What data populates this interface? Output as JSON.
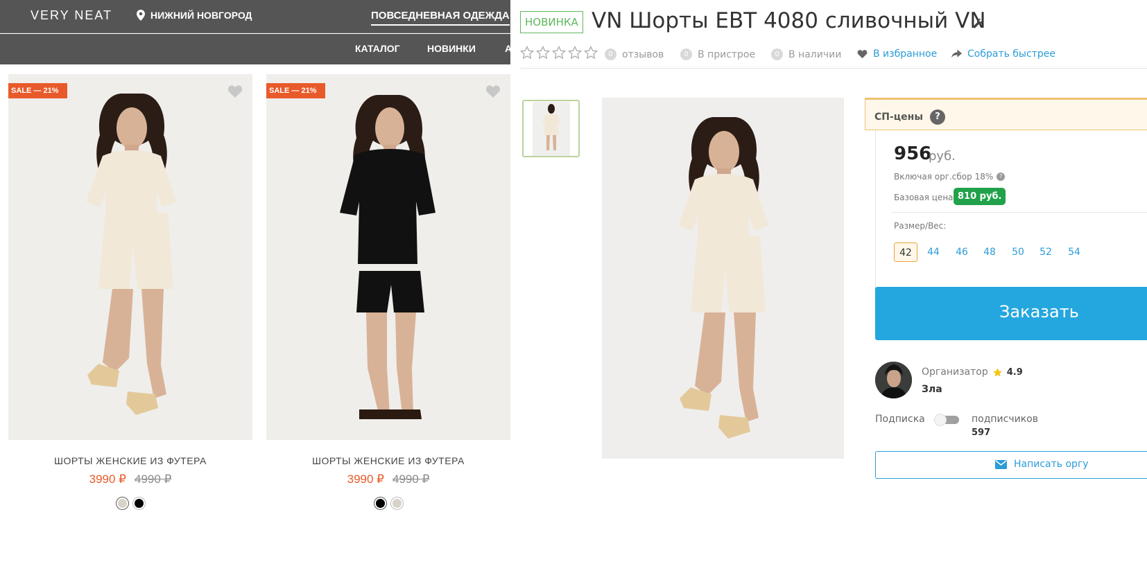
{
  "store": {
    "logo": "VERY NEAT",
    "city": "НИЖНИЙ НОВГОРОД",
    "category_link": "ПОВСЕДНЕВНАЯ ОДЕЖДА",
    "nav": [
      "КАТАЛОГ",
      "НОВИНКИ",
      "А"
    ],
    "products": [
      {
        "sale_badge": "SALE — 21%",
        "title": "ШОРТЫ ЖЕНСКИЕ ИЗ ФУТЕРА",
        "price": "3990 ₽",
        "old_price": "4990 ₽",
        "colors": [
          "#d8d3c8",
          "#000000"
        ],
        "selected_color": 0
      },
      {
        "sale_badge": "SALE — 21%",
        "title": "ШОРТЫ ЖЕНСКИЕ ИЗ ФУТЕРА",
        "price": "3990 ₽",
        "old_price": "4990 ₽",
        "colors": [
          "#000000",
          "#d8d3c8"
        ],
        "selected_color": 0
      }
    ],
    "accent_color": "#e95a2a"
  },
  "product": {
    "new_badge": "НОВИНКА",
    "title": "VN Шорты EBT 4080 сливочный VN",
    "reviews": {
      "count": "0",
      "label": "отзывов",
      "stars": 0
    },
    "in_pristroy": {
      "count": "0",
      "label": "В пристрое"
    },
    "in_stock": {
      "count": "0",
      "label": "В наличии"
    },
    "favorite": "В избранное",
    "collect_faster": "Собрать быстрее",
    "sp_prices_label": "СП-цены",
    "price": "956",
    "currency": "руб.",
    "including_fee": "Включая орг.сбор 18%",
    "base_price_label": "Базовая цена",
    "base_price": "810 руб.",
    "size_label": "Размер/Вес:",
    "sizes": [
      "42",
      "44",
      "46",
      "48",
      "50",
      "52",
      "54"
    ],
    "selected_size": "42",
    "order_button": "Заказать",
    "organizer_label": "Организатор",
    "organizer_rating": "4.9",
    "organizer_name": "Зла",
    "subscription_label": "Подписка",
    "subscribers_label": "подписчиков",
    "subscribers_count": "597",
    "write_button": "Написать оргу",
    "colors": {
      "green": "#21a24a",
      "blue": "#24a7df",
      "link": "#2b9cd8"
    }
  }
}
